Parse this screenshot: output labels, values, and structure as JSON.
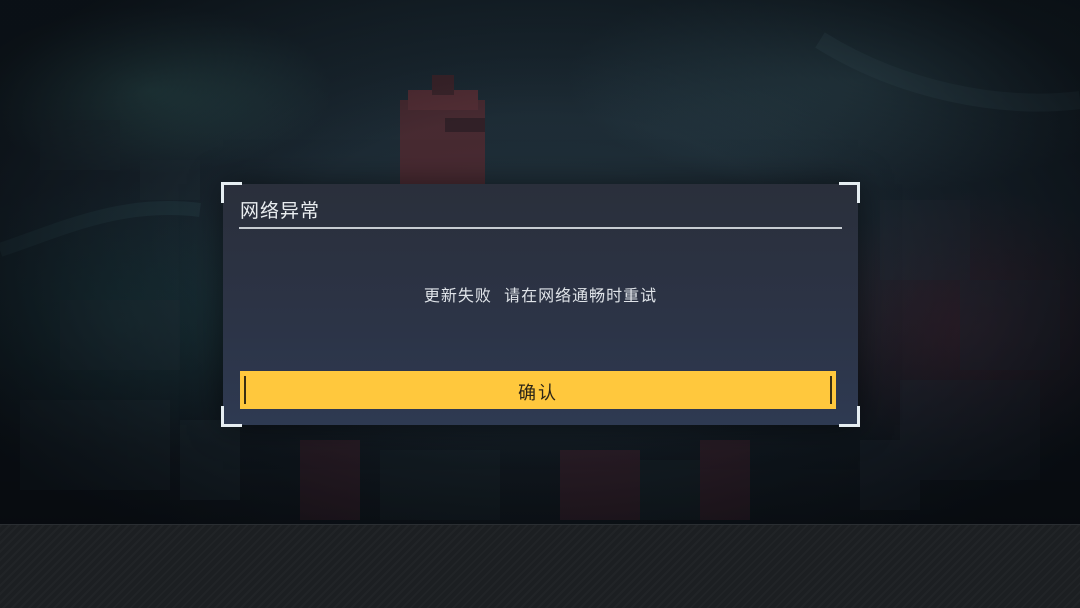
{
  "dialog": {
    "title": "网络异常",
    "message": "更新失败  请在网络通畅时重试",
    "confirm_label": "确认"
  },
  "colors": {
    "button_accent": "#ffc83d",
    "dialog_background": "#2c3447",
    "corner_bracket": "#e6eef2"
  }
}
